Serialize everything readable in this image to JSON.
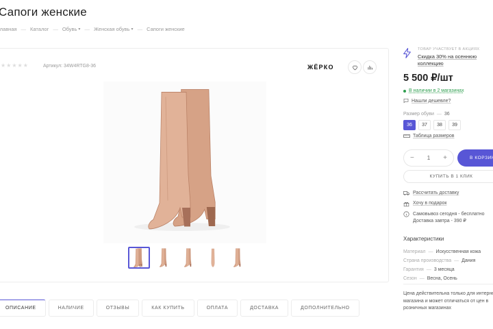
{
  "page": {
    "title": "Сапоги женские"
  },
  "breadcrumb": [
    "Главная",
    "Каталог",
    "Обувь",
    "Женская обувь",
    "Сапоги женские"
  ],
  "product": {
    "article_label": "Артикул:",
    "article": "34W4RTG8-36",
    "brand": "ЖЁРКО",
    "rating_stars": 0
  },
  "promo": {
    "caption": "ТОВАР УЧАСТВУЕТ В АКЦИЯХ",
    "link": "Скидка 30% на осеннюю коллекцию"
  },
  "price": "5 500 ₽/шт",
  "availability": "В наличии в 2 магазинах",
  "cheaper_link": "Нашли дешевле?",
  "size": {
    "label": "Размер обуви",
    "selected": "36",
    "options": [
      "36",
      "37",
      "38",
      "39"
    ],
    "table_link": "Таблица размеров"
  },
  "quantity": "1",
  "buttons": {
    "cart": "В КОРЗИНУ",
    "one_click": "КУПИТЬ В 1 КЛИК"
  },
  "info": {
    "delivery": "Рассчитать доставку",
    "gift": "Хочу в подарок",
    "pickup": "Самовывоз сегодня - бесплатно",
    "delivery_tomorrow": "Доставка завтра - 390 ₽"
  },
  "characteristics": {
    "title": "Характеристики",
    "rows": [
      {
        "label": "Материал",
        "value": "Искусственная кожа"
      },
      {
        "label": "Страна производства",
        "value": "Дания"
      },
      {
        "label": "Гарантия",
        "value": "3 месяца"
      },
      {
        "label": "Сезон",
        "value": "Весна, Осень"
      }
    ]
  },
  "disclaimer": "Цена действительна только для интернет-магазина и может отличаться от цен в розничных магазинах",
  "tabs": [
    "ОПИСАНИЕ",
    "НАЛИЧИЕ",
    "ОТЗЫВЫ",
    "КАК КУПИТЬ",
    "ОПЛАТА",
    "ДОСТАВКА",
    "ДОПОЛНИТЕЛЬНО"
  ],
  "colors": {
    "accent": "#5856d6",
    "in_stock": "#2e9e4f",
    "boot": "#d9a98e"
  }
}
